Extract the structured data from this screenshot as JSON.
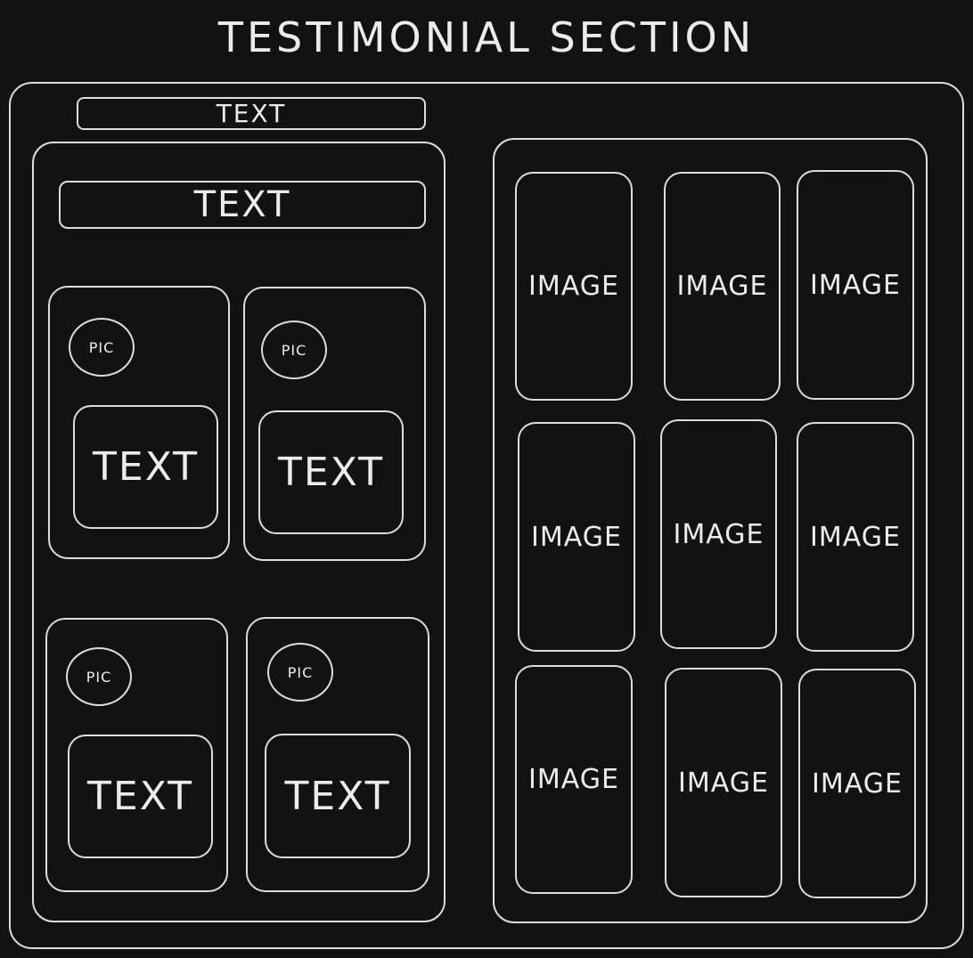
{
  "title": "TESTIMONIAL SECTION",
  "outer_label": "TEXT",
  "left_panel": {
    "heading": "TEXT",
    "cards": [
      {
        "pic": "PIC",
        "text": "TEXT"
      },
      {
        "pic": "PIC",
        "text": "TEXT"
      },
      {
        "pic": "PIC",
        "text": "TEXT"
      },
      {
        "pic": "PIC",
        "text": "TEXT"
      }
    ]
  },
  "right_panel": {
    "images": [
      "IMAGE",
      "IMAGE",
      "IMAGE",
      "IMAGE",
      "IMAGE",
      "IMAGE",
      "IMAGE",
      "IMAGE",
      "IMAGE"
    ]
  },
  "colors": {
    "background": "#121212",
    "stroke": "#dcdcdc",
    "text": "#ececec"
  }
}
